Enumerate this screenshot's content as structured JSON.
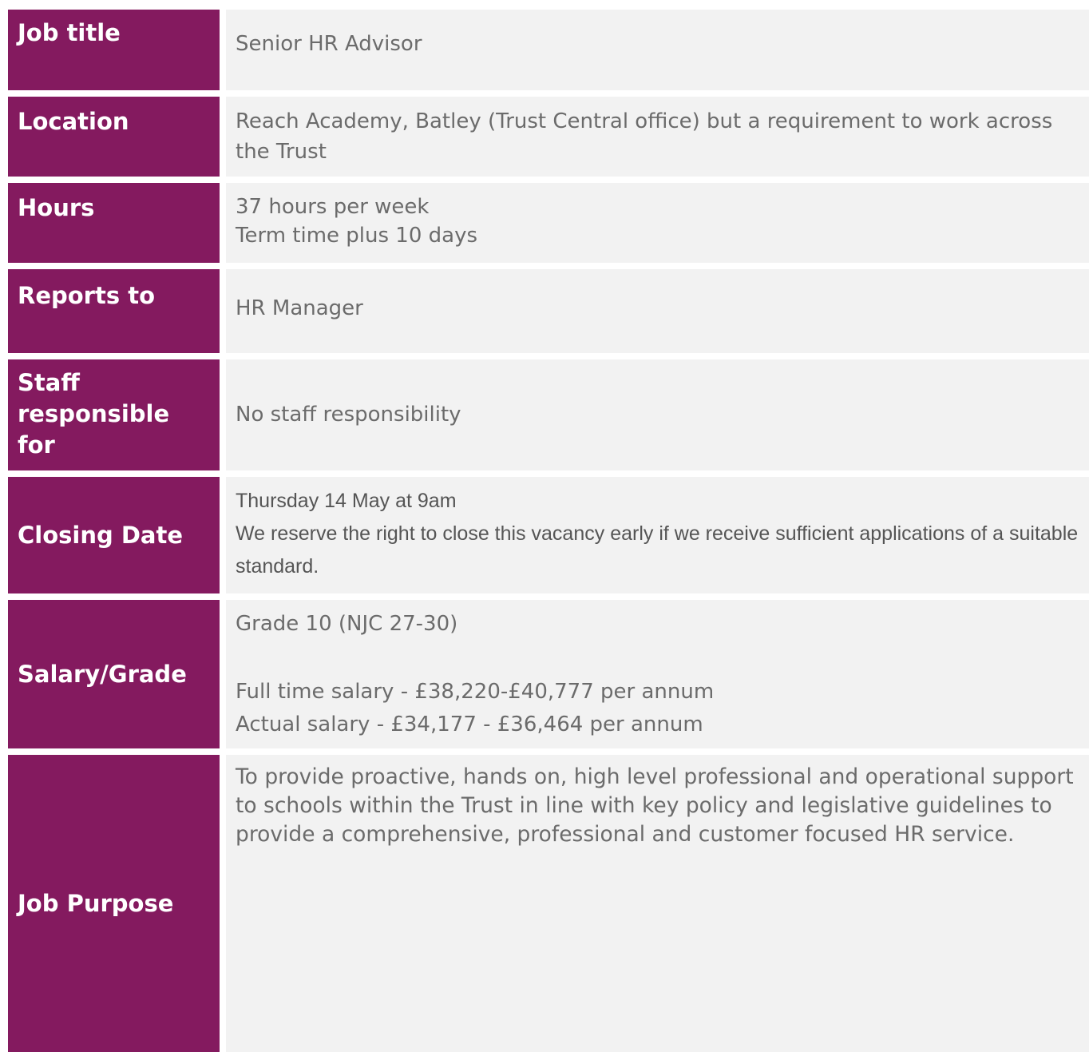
{
  "rows": [
    {
      "label": "Job title",
      "value": [
        "Senior HR Advisor"
      ]
    },
    {
      "label": "Location",
      "value": [
        "Reach Academy, Batley (Trust Central office) but a requirement to work across the Trust"
      ]
    },
    {
      "label": "Hours",
      "value": [
        "37 hours per week",
        "Term time plus 10 days"
      ]
    },
    {
      "label": "Reports to",
      "value": [
        "HR Manager"
      ]
    },
    {
      "label": "Staff responsible for",
      "value": [
        "No staff responsibility"
      ]
    },
    {
      "label": "Closing Date",
      "value": [
        "Thursday 14 May at 9am",
        "We reserve the right to close this vacancy early if we receive sufficient applications of a suitable standard."
      ]
    },
    {
      "label": "Salary/Grade",
      "value": [
        "Grade 10 (NJC 27-30)",
        "Full time salary - £38,220-£40,777 per annum",
        "Actual salary - £34,177 - £36,464 per annum"
      ]
    },
    {
      "label": "Job Purpose",
      "value": [
        "To provide proactive, hands on, high level professional and operational support to schools within the Trust in line with key policy and legislative guidelines to provide a comprehensive, professional and customer focused HR service."
      ]
    }
  ],
  "colors": {
    "label_background": "#841a5f",
    "label_text": "#ffffff",
    "value_background": "#f2f2f2",
    "value_text": "#6b6b6b"
  }
}
